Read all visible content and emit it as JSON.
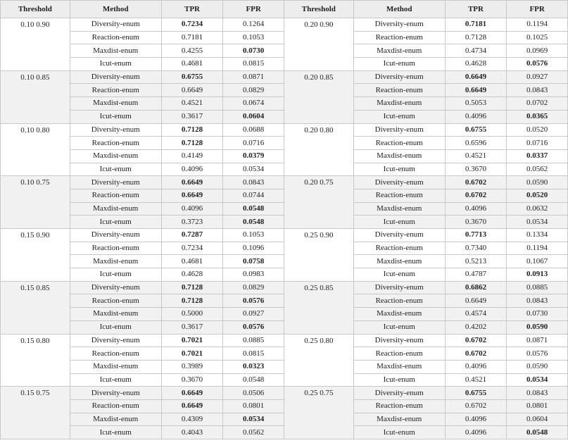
{
  "headers": [
    "Threshold",
    "Method",
    "TPR",
    "FPR",
    "Threshold",
    "Method",
    "TPR",
    "FPR"
  ],
  "left_groups": [
    {
      "threshold": "0.10 0.90",
      "rows": [
        {
          "method": "Diversity-enum",
          "tpr": "0.7234",
          "fpr": "0.1264",
          "tpr_bold": true,
          "fpr_bold": false
        },
        {
          "method": "Reaction-enum",
          "tpr": "0.7181",
          "fpr": "0.1053",
          "tpr_bold": false,
          "fpr_bold": false
        },
        {
          "method": "Maxdist-enum",
          "tpr": "0.4255",
          "fpr": "0.0730",
          "tpr_bold": false,
          "fpr_bold": true
        },
        {
          "method": "Icut-enum",
          "tpr": "0.4681",
          "fpr": "0.0815",
          "tpr_bold": false,
          "fpr_bold": false
        }
      ]
    },
    {
      "threshold": "0.10 0.85",
      "rows": [
        {
          "method": "Diversity-enum",
          "tpr": "0.6755",
          "fpr": "0.0871",
          "tpr_bold": true,
          "fpr_bold": false
        },
        {
          "method": "Reaction-enum",
          "tpr": "0.6649",
          "fpr": "0.0829",
          "tpr_bold": false,
          "fpr_bold": false
        },
        {
          "method": "Maxdist-enum",
          "tpr": "0.4521",
          "fpr": "0.0674",
          "tpr_bold": false,
          "fpr_bold": false
        },
        {
          "method": "Icut-enum",
          "tpr": "0.3617",
          "fpr": "0.0604",
          "tpr_bold": false,
          "fpr_bold": true
        }
      ]
    },
    {
      "threshold": "0.10 0.80",
      "rows": [
        {
          "method": "Diversity-enum",
          "tpr": "0.7128",
          "fpr": "0.0688",
          "tpr_bold": true,
          "fpr_bold": false
        },
        {
          "method": "Reaction-enum",
          "tpr": "0.7128",
          "fpr": "0.0716",
          "tpr_bold": true,
          "fpr_bold": false
        },
        {
          "method": "Maxdist-enum",
          "tpr": "0.4149",
          "fpr": "0.0379",
          "tpr_bold": false,
          "fpr_bold": true
        },
        {
          "method": "Icut-enum",
          "tpr": "0.4096",
          "fpr": "0.0534",
          "tpr_bold": false,
          "fpr_bold": false
        }
      ]
    },
    {
      "threshold": "0.10 0.75",
      "rows": [
        {
          "method": "Diversity-enum",
          "tpr": "0.6649",
          "fpr": "0.0843",
          "tpr_bold": true,
          "fpr_bold": false
        },
        {
          "method": "Reaction-enum",
          "tpr": "0.6649",
          "fpr": "0.0744",
          "tpr_bold": true,
          "fpr_bold": false
        },
        {
          "method": "Maxdist-enum",
          "tpr": "0.4096",
          "fpr": "0.0548",
          "tpr_bold": false,
          "fpr_bold": true
        },
        {
          "method": "Icut-enum",
          "tpr": "0.3723",
          "fpr": "0.0548",
          "tpr_bold": false,
          "fpr_bold": true
        }
      ]
    },
    {
      "threshold": "0.15 0.90",
      "rows": [
        {
          "method": "Diversity-enum",
          "tpr": "0.7287",
          "fpr": "0.1053",
          "tpr_bold": true,
          "fpr_bold": false
        },
        {
          "method": "Reaction-enum",
          "tpr": "0.7234",
          "fpr": "0.1096",
          "tpr_bold": false,
          "fpr_bold": false
        },
        {
          "method": "Maxdist-enum",
          "tpr": "0.4681",
          "fpr": "0.0758",
          "tpr_bold": false,
          "fpr_bold": true
        },
        {
          "method": "Icut-enum",
          "tpr": "0.4628",
          "fpr": "0.0983",
          "tpr_bold": false,
          "fpr_bold": false
        }
      ]
    },
    {
      "threshold": "0.15 0.85",
      "rows": [
        {
          "method": "Diversity-enum",
          "tpr": "0.7128",
          "fpr": "0.0829",
          "tpr_bold": true,
          "fpr_bold": false
        },
        {
          "method": "Reaction-enum",
          "tpr": "0.7128",
          "fpr": "0.0576",
          "tpr_bold": true,
          "fpr_bold": true
        },
        {
          "method": "Maxdist-enum",
          "tpr": "0.5000",
          "fpr": "0.0927",
          "tpr_bold": false,
          "fpr_bold": false
        },
        {
          "method": "Icut-enum",
          "tpr": "0.3617",
          "fpr": "0.0576",
          "tpr_bold": false,
          "fpr_bold": true
        }
      ]
    },
    {
      "threshold": "0.15 0.80",
      "rows": [
        {
          "method": "Diversity-enum",
          "tpr": "0.7021",
          "fpr": "0.0885",
          "tpr_bold": true,
          "fpr_bold": false
        },
        {
          "method": "Reaction-enum",
          "tpr": "0.7021",
          "fpr": "0.0815",
          "tpr_bold": true,
          "fpr_bold": false
        },
        {
          "method": "Maxdist-enum",
          "tpr": "0.3989",
          "fpr": "0.0323",
          "tpr_bold": false,
          "fpr_bold": true
        },
        {
          "method": "Icut-enum",
          "tpr": "0.3670",
          "fpr": "0.0548",
          "tpr_bold": false,
          "fpr_bold": false
        }
      ]
    },
    {
      "threshold": "0.15 0.75",
      "rows": [
        {
          "method": "Diversity-enum",
          "tpr": "0.6649",
          "fpr": "0.0506",
          "tpr_bold": true,
          "fpr_bold": false
        },
        {
          "method": "Reaction-enum",
          "tpr": "0.6649",
          "fpr": "0.0801",
          "tpr_bold": true,
          "fpr_bold": false
        },
        {
          "method": "Maxdist-enum",
          "tpr": "0.4309",
          "fpr": "0.0534",
          "tpr_bold": false,
          "fpr_bold": true
        },
        {
          "method": "Icut-enum",
          "tpr": "0.4043",
          "fpr": "0.0562",
          "tpr_bold": false,
          "fpr_bold": false
        }
      ]
    }
  ],
  "right_groups": [
    {
      "threshold": "0.20 0.90",
      "rows": [
        {
          "method": "Diversity-enum",
          "tpr": "0.7181",
          "fpr": "0.1194",
          "tpr_bold": true,
          "fpr_bold": false
        },
        {
          "method": "Reaction-enum",
          "tpr": "0.7128",
          "fpr": "0.1025",
          "tpr_bold": false,
          "fpr_bold": false
        },
        {
          "method": "Maxdist-enum",
          "tpr": "0.4734",
          "fpr": "0.0969",
          "tpr_bold": false,
          "fpr_bold": false
        },
        {
          "method": "Icut-enum",
          "tpr": "0.4628",
          "fpr": "0.0576",
          "tpr_bold": false,
          "fpr_bold": true
        }
      ]
    },
    {
      "threshold": "0.20 0.85",
      "rows": [
        {
          "method": "Diversity-enum",
          "tpr": "0.6649",
          "fpr": "0.0927",
          "tpr_bold": true,
          "fpr_bold": false
        },
        {
          "method": "Reaction-enum",
          "tpr": "0.6649",
          "fpr": "0.0843",
          "tpr_bold": true,
          "fpr_bold": false
        },
        {
          "method": "Maxdist-enum",
          "tpr": "0.5053",
          "fpr": "0.0702",
          "tpr_bold": false,
          "fpr_bold": false
        },
        {
          "method": "Icut-enum",
          "tpr": "0.4096",
          "fpr": "0.0365",
          "tpr_bold": false,
          "fpr_bold": true
        }
      ]
    },
    {
      "threshold": "0.20 0.80",
      "rows": [
        {
          "method": "Diversity-enum",
          "tpr": "0.6755",
          "fpr": "0.0520",
          "tpr_bold": true,
          "fpr_bold": false
        },
        {
          "method": "Reaction-enum",
          "tpr": "0.6596",
          "fpr": "0.0716",
          "tpr_bold": false,
          "fpr_bold": false
        },
        {
          "method": "Maxdist-enum",
          "tpr": "0.4521",
          "fpr": "0.0337",
          "tpr_bold": false,
          "fpr_bold": true
        },
        {
          "method": "Icut-enum",
          "tpr": "0.3670",
          "fpr": "0.0562",
          "tpr_bold": false,
          "fpr_bold": false
        }
      ]
    },
    {
      "threshold": "0.20 0.75",
      "rows": [
        {
          "method": "Diversity-enum",
          "tpr": "0.6702",
          "fpr": "0.0590",
          "tpr_bold": true,
          "fpr_bold": false
        },
        {
          "method": "Reaction-enum",
          "tpr": "0.6702",
          "fpr": "0.0520",
          "tpr_bold": true,
          "fpr_bold": true
        },
        {
          "method": "Maxdist-enum",
          "tpr": "0.4096",
          "fpr": "0.0632",
          "tpr_bold": false,
          "fpr_bold": false
        },
        {
          "method": "Icut-enum",
          "tpr": "0.3670",
          "fpr": "0.0534",
          "tpr_bold": false,
          "fpr_bold": false
        }
      ]
    },
    {
      "threshold": "0.25 0.90",
      "rows": [
        {
          "method": "Diversity-enum",
          "tpr": "0.7713",
          "fpr": "0.1334",
          "tpr_bold": true,
          "fpr_bold": false
        },
        {
          "method": "Reaction-enum",
          "tpr": "0.7340",
          "fpr": "0.1194",
          "tpr_bold": false,
          "fpr_bold": false
        },
        {
          "method": "Maxdist-enum",
          "tpr": "0.5213",
          "fpr": "0.1067",
          "tpr_bold": false,
          "fpr_bold": false
        },
        {
          "method": "Icut-enum",
          "tpr": "0.4787",
          "fpr": "0.0913",
          "tpr_bold": false,
          "fpr_bold": true
        }
      ]
    },
    {
      "threshold": "0.25 0.85",
      "rows": [
        {
          "method": "Diversity-enum",
          "tpr": "0.6862",
          "fpr": "0.0885",
          "tpr_bold": true,
          "fpr_bold": false
        },
        {
          "method": "Reaction-enum",
          "tpr": "0.6649",
          "fpr": "0.0843",
          "tpr_bold": false,
          "fpr_bold": false
        },
        {
          "method": "Maxdist-enum",
          "tpr": "0.4574",
          "fpr": "0.0730",
          "tpr_bold": false,
          "fpr_bold": false
        },
        {
          "method": "Icut-enum",
          "tpr": "0.4202",
          "fpr": "0.0590",
          "tpr_bold": false,
          "fpr_bold": true
        }
      ]
    },
    {
      "threshold": "0.25 0.80",
      "rows": [
        {
          "method": "Diversity-enum",
          "tpr": "0.6702",
          "fpr": "0.0871",
          "tpr_bold": true,
          "fpr_bold": false
        },
        {
          "method": "Reaction-enum",
          "tpr": "0.6702",
          "fpr": "0.0576",
          "tpr_bold": true,
          "fpr_bold": false
        },
        {
          "method": "Maxdist-enum",
          "tpr": "0.4096",
          "fpr": "0.0590",
          "tpr_bold": false,
          "fpr_bold": false
        },
        {
          "method": "Icut-enum",
          "tpr": "0.4521",
          "fpr": "0.0534",
          "tpr_bold": false,
          "fpr_bold": true
        }
      ]
    },
    {
      "threshold": "0.25 0.75",
      "rows": [
        {
          "method": "Diversity-enum",
          "tpr": "0.6755",
          "fpr": "0.0843",
          "tpr_bold": true,
          "fpr_bold": false
        },
        {
          "method": "Reaction-enum",
          "tpr": "0.6702",
          "fpr": "0.0801",
          "tpr_bold": false,
          "fpr_bold": false
        },
        {
          "method": "Maxdist-enum",
          "tpr": "0.4096",
          "fpr": "0.0604",
          "tpr_bold": false,
          "fpr_bold": false
        },
        {
          "method": "Icut-enum",
          "tpr": "0.4096",
          "fpr": "0.0548",
          "tpr_bold": false,
          "fpr_bold": true
        }
      ]
    }
  ],
  "colors": {
    "header_bg": "#ededed",
    "shaded_group_bg": "#f1f1f1",
    "border": "#c8c8c8"
  }
}
